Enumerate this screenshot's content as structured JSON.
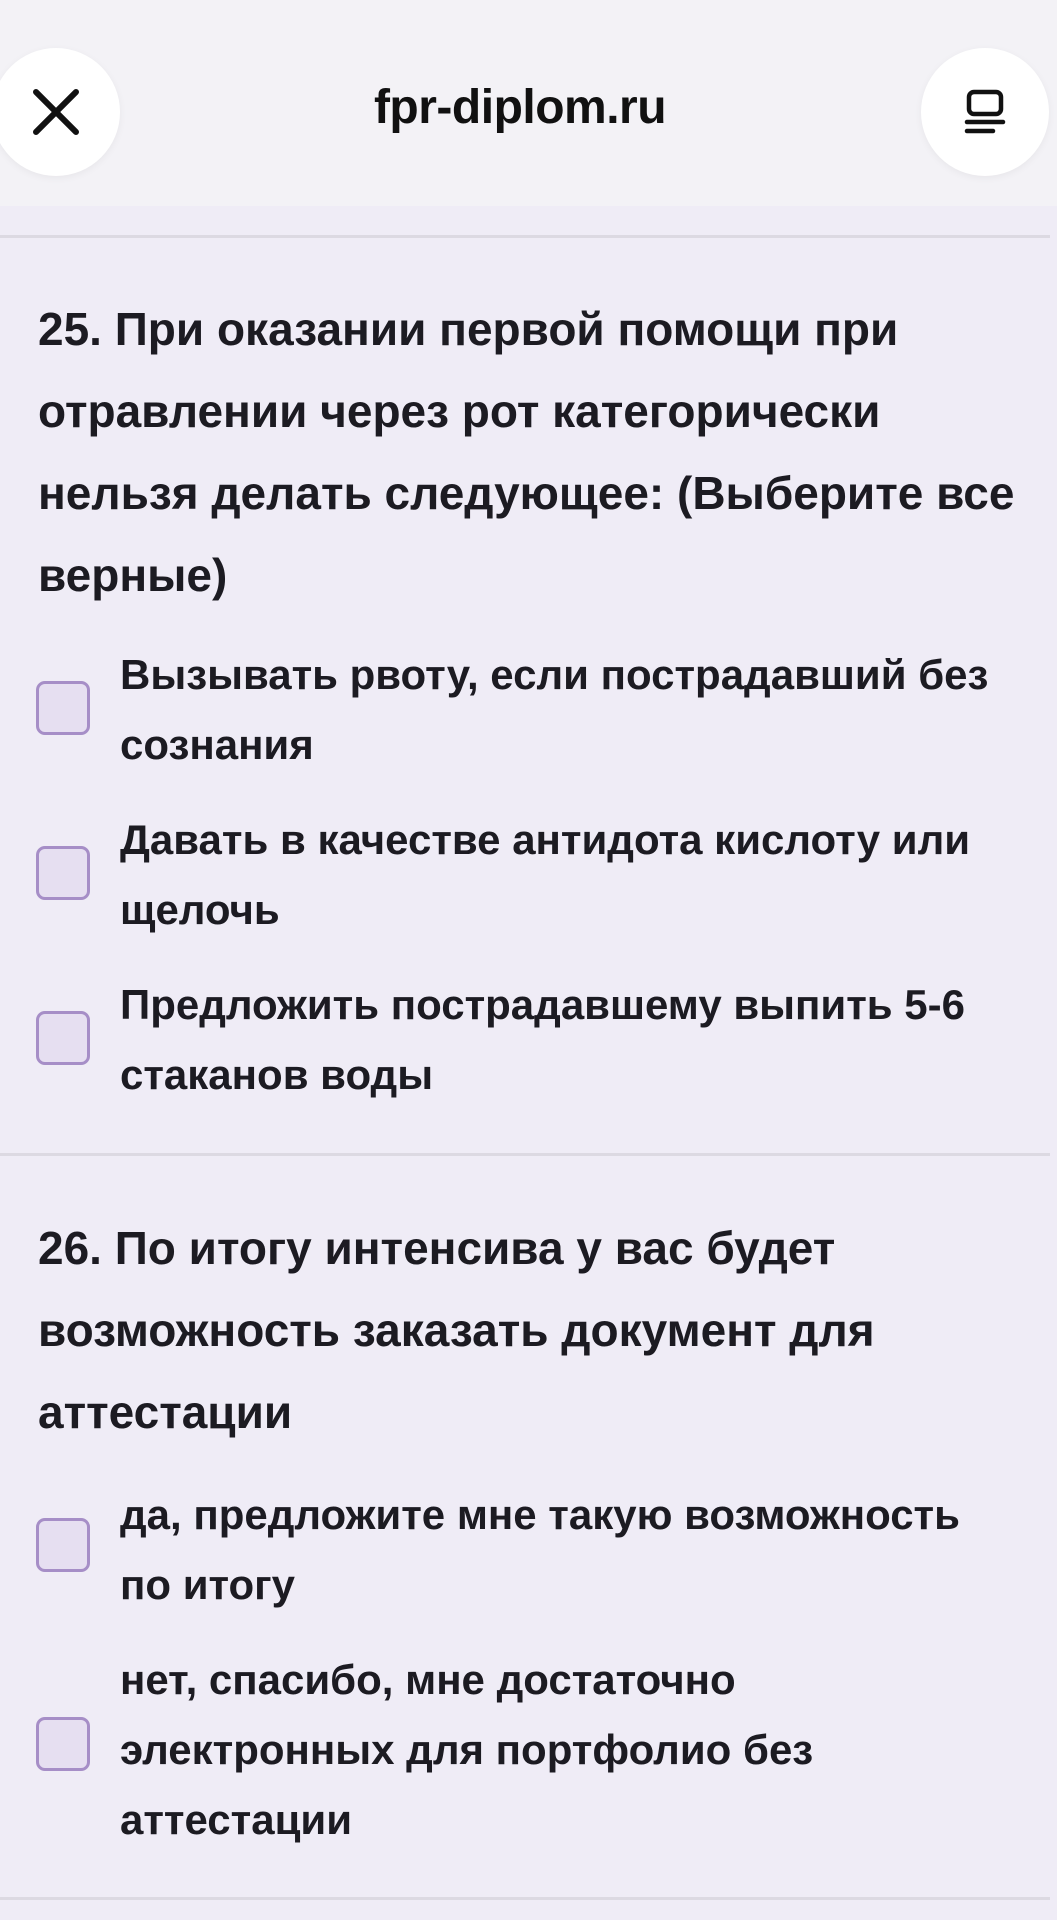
{
  "browser": {
    "site_title": "fpr-diplom.ru",
    "close_icon": "close-icon",
    "menu_icon": "reader-mode-icon"
  },
  "questions": [
    {
      "text": "25. При оказании первой помощи при отравлении через рот категорически нельзя делать следующее: (Выберите все верные)",
      "options": [
        {
          "label": "Вызывать рвоту, если пострадавший без сознания",
          "checked": false
        },
        {
          "label": "Давать в качестве антидота кислоту или щелочь",
          "checked": false
        },
        {
          "label": "Предложить пострадавшему выпить 5-6 стаканов воды",
          "checked": false
        }
      ]
    },
    {
      "text": "26. По итогу интенсива у вас будет возможность заказать документ для аттестации",
      "options": [
        {
          "label": "да, предложите мне такую возможность по итогу",
          "checked": false
        },
        {
          "label": "нет, спасибо, мне достаточно электронных для портфолио без аттестации",
          "checked": false
        }
      ]
    }
  ],
  "colors": {
    "background": "#efecf6",
    "checkbox_border": "#a68ec7",
    "checkbox_fill": "#e6dff1"
  }
}
